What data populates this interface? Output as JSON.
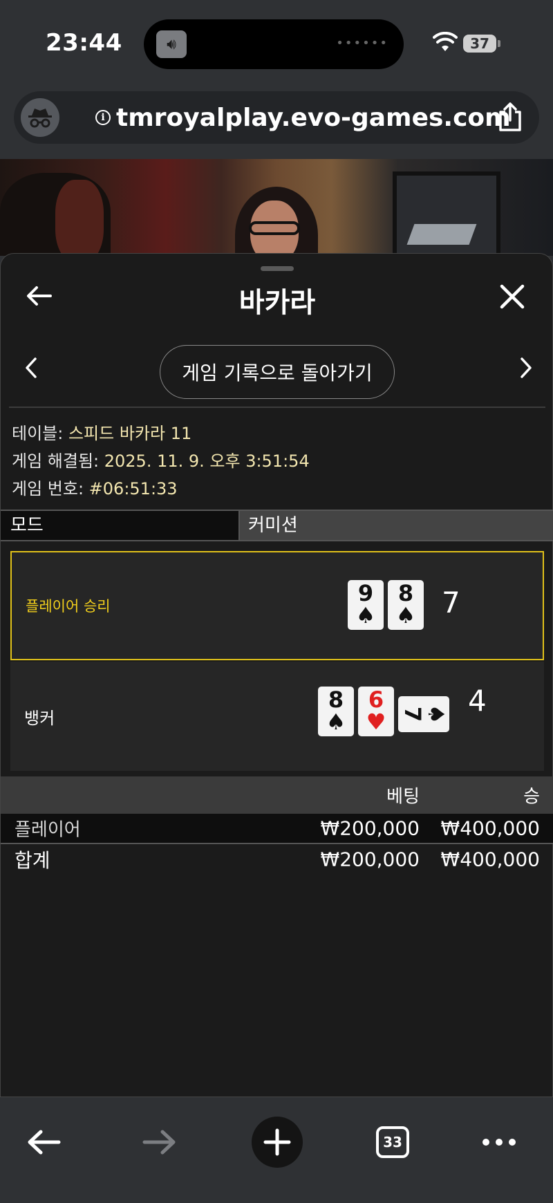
{
  "status_bar": {
    "time": "23:44",
    "battery": "37"
  },
  "browser": {
    "url": "tmroyalplay.evo-games.com"
  },
  "sheet": {
    "title": "바카라",
    "history_button": "게임 기록으로 돌아가기",
    "info": {
      "table_label": "테이블: ",
      "table_value": "스피드 바카라 11",
      "resolved_label": "게임 해결됨: ",
      "resolved_value": "2025. 11. 9. 오후 3:51:54",
      "number_label": "게임 번호: ",
      "number_value": "#06:51:33"
    },
    "mode_label": "모드",
    "commission_label": "커미션",
    "player": {
      "label": "플레이어 승리",
      "cards": [
        {
          "rank": "9",
          "suit": "♠"
        },
        {
          "rank": "8",
          "suit": "♠"
        }
      ],
      "score": "7"
    },
    "banker": {
      "label": "뱅커",
      "cards": [
        {
          "rank": "8",
          "suit": "♠"
        },
        {
          "rank": "6",
          "suit": "♥"
        },
        {
          "rank": "7",
          "suit": "♠"
        }
      ],
      "score": "4"
    },
    "bets": {
      "header": {
        "bet": "베팅",
        "win": "승"
      },
      "rows": [
        {
          "name": "플레이어",
          "bet": "₩200,000",
          "win": "₩400,000"
        }
      ],
      "total": {
        "name": "합계",
        "bet": "₩200,000",
        "win": "₩400,000"
      }
    }
  },
  "toolbar": {
    "tab_count": "33"
  }
}
